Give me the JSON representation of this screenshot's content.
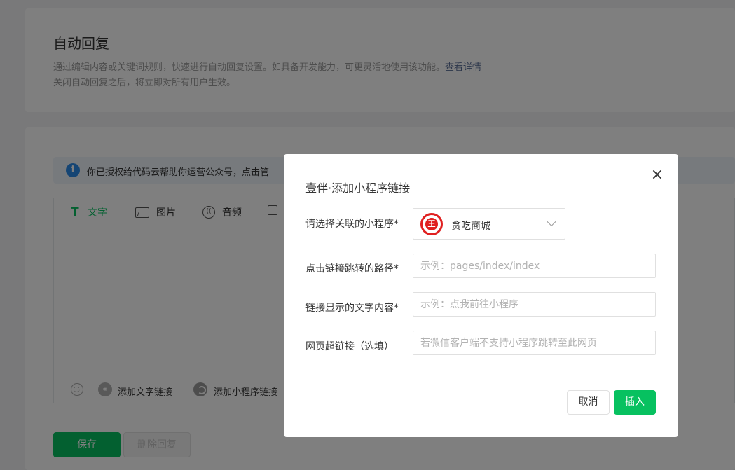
{
  "page": {
    "title": "自动回复",
    "desc_line1": "通过编辑内容或关键词规则，快速进行自动回复设置。如具备开发能力，可更灵活地使用该功能。",
    "desc_link": "查看详情",
    "desc_line2": "关闭自动回复之后，将立即对所有用户生效。"
  },
  "notice": {
    "icon": "info-icon",
    "text": "你已授权给代码云帮助你运营公众号，点击管"
  },
  "editor": {
    "tabs": [
      {
        "label": "文字",
        "icon": "text-icon",
        "active": true
      },
      {
        "label": "图片",
        "icon": "image-icon"
      },
      {
        "label": "音频",
        "icon": "audio-icon"
      },
      {
        "label": "",
        "icon": "video-icon"
      }
    ],
    "bottom": {
      "emoji_icon": "emoji-icon",
      "add_text_link": "添加文字链接",
      "add_miniprogram_link": "添加小程序链接"
    }
  },
  "actions": {
    "save": "保存",
    "delete": "删除回复"
  },
  "dialog": {
    "title": "壹伴·添加小程序链接",
    "close": "×",
    "fields": {
      "miniprogram_label": "请选择关联的小程序*",
      "miniprogram_value": "贪吃商城",
      "path_label": "点击链接跳转的路径*",
      "path_placeholder": "示例：pages/index/index",
      "text_label": "链接显示的文字内容*",
      "text_placeholder": "示例：点我前往小程序",
      "url_label": "网页超链接（选填）",
      "url_placeholder": "若微信客户端不支持小程序跳转至此网页"
    },
    "cancel": "取消",
    "insert": "插入"
  },
  "colors": {
    "accent": "#07c160",
    "link": "#576b95",
    "info": "#2b8ae8",
    "logo_red": "#e02020"
  }
}
